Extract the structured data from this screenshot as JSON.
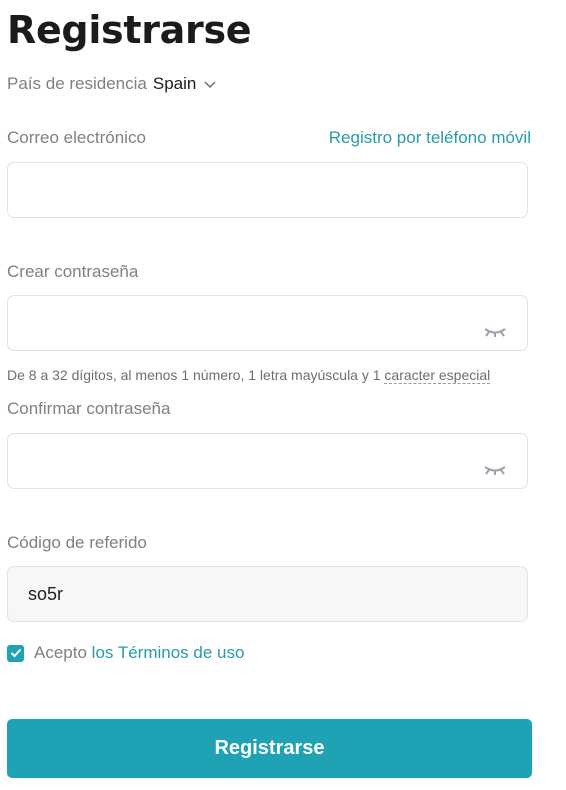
{
  "title": "Registrarse",
  "residence": {
    "label": "País de residencia",
    "country": "Spain",
    "icon": "chevron-down-icon"
  },
  "email": {
    "label": "Correo electrónico",
    "switch_link": "Registro por teléfono móvil",
    "value": "",
    "placeholder": ""
  },
  "password": {
    "label": "Crear contraseña",
    "value": "",
    "placeholder": "",
    "icon": "eye-closed-icon",
    "hint_prefix": "De 8 a 32 dígitos, al menos 1 número, 1 letra mayúscula y 1 ",
    "hint_link": "caracter especial"
  },
  "confirm_password": {
    "label": "Confirmar contraseña",
    "value": "",
    "placeholder": "",
    "icon": "eye-closed-icon"
  },
  "referral": {
    "label": "Código de referido",
    "value": "so5r"
  },
  "terms": {
    "checked": true,
    "prefix": "Acepto",
    "link": "los Términos de uso"
  },
  "submit_label": "Registrarse",
  "colors": {
    "accent": "#1fa3b4",
    "link": "#2a9aa9",
    "label": "#808080",
    "border": "#e3e3e3"
  }
}
